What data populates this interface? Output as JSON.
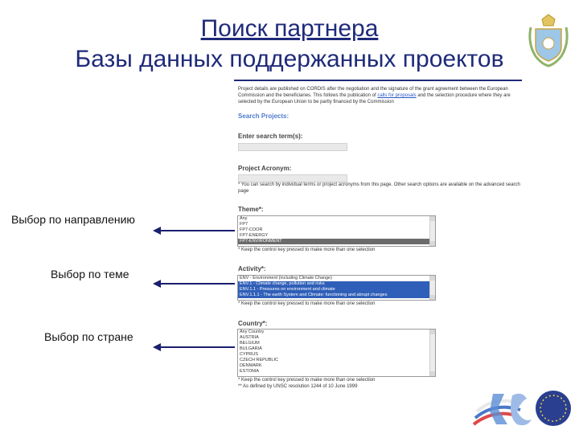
{
  "header": {
    "title_line1": "Поиск партнера",
    "title_line2": "Базы данных поддержанных проектов"
  },
  "intro": {
    "text_before_link": "Project details are published on CORDIS after the negotiation and the signature of the grant agreement between the European Commission and the beneficiaries. This follows the publication of ",
    "link": "calls for proposals",
    "text_after_link": " and the selection procedure where they are selected by the European Union to be partly financed by the Commission"
  },
  "search": {
    "heading": "Search Projects:",
    "term_label": "Enter search term(s):",
    "acronym_label": "Project Acronym:",
    "acronym_note": "* You can search by individual terms or project acronyms from this page. Other search options are available on the advanced search page"
  },
  "theme": {
    "label": "Theme*:",
    "options": [
      "Any",
      "FP7",
      "FP7-COOR",
      "FP7-ENERGY",
      "FP7-ENVIRONMENT"
    ],
    "selected_index": 4,
    "note": "* Keep the control key pressed to make more than one selection"
  },
  "activity": {
    "label": "Activity*:",
    "options": [
      "ENV - Environment (including Climate Change)",
      "ENV.1 - Climate change, pollution and risks",
      "ENV.1.1 - Pressures on environment and climate",
      "ENV.1.1.1 - The earth System and Climate: functioning and abrupt changes"
    ],
    "selected": [
      1,
      2,
      3
    ],
    "note": "* Keep the control key pressed to make more than one selection"
  },
  "country": {
    "label": "Country*:",
    "options": [
      "Any Country",
      "AUSTRIA",
      "BELGIUM",
      "BULGARIA",
      "CYPRUS",
      "CZECH REPUBLIC",
      "DENMARK",
      "ESTONIA"
    ],
    "note1": "* Keep the control key pressed to make more than one selection",
    "note2": "** As defined by UNSC resolution 1244 of 10 June 1999"
  },
  "annotations": {
    "by_direction": "Выбор по направлению",
    "by_theme": "Выбор по теме",
    "by_country": "Выбор по стране"
  },
  "colors": {
    "title": "#1f2a7a",
    "arrow": "#1a1f6e",
    "heading_blue": "#4f7bd0",
    "selection_blue": "#2f5fb8"
  }
}
